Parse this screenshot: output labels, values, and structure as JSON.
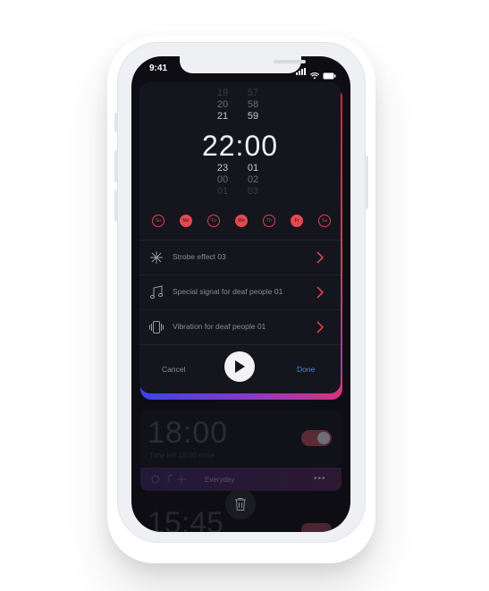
{
  "status": {
    "time": "9:41"
  },
  "picker": {
    "hours_above": [
      "19",
      "20",
      "21"
    ],
    "minutes_above": [
      "57",
      "58",
      "59"
    ],
    "current": "22:00",
    "hours_below": [
      "23",
      "00",
      "01"
    ],
    "minutes_below": [
      "01",
      "02",
      "03"
    ]
  },
  "days": [
    {
      "label": "Su",
      "active": false
    },
    {
      "label": "Mo",
      "active": true
    },
    {
      "label": "Tu",
      "active": false
    },
    {
      "label": "We",
      "active": true
    },
    {
      "label": "Th",
      "active": false
    },
    {
      "label": "Fr",
      "active": true
    },
    {
      "label": "Sa",
      "active": false
    }
  ],
  "options": [
    {
      "icon": "sparkle-icon",
      "label": "Strobe effect 03"
    },
    {
      "icon": "music-note-icon",
      "label": "Special signal for deaf people 01"
    },
    {
      "icon": "vibration-icon",
      "label": "Vibration for deaf people 01"
    }
  ],
  "actions": {
    "cancel": "Cancel",
    "done": "Done"
  },
  "background_alarm": {
    "time": "18:00",
    "subtitle": "Time left 18:00 more",
    "repeat": "Everyday",
    "next_time": "15:45"
  },
  "colors": {
    "accent_red": "#e5484f",
    "done_blue": "#3c86ff",
    "gradient_blue": "#3a43e8",
    "gradient_red": "#e01e3c"
  }
}
